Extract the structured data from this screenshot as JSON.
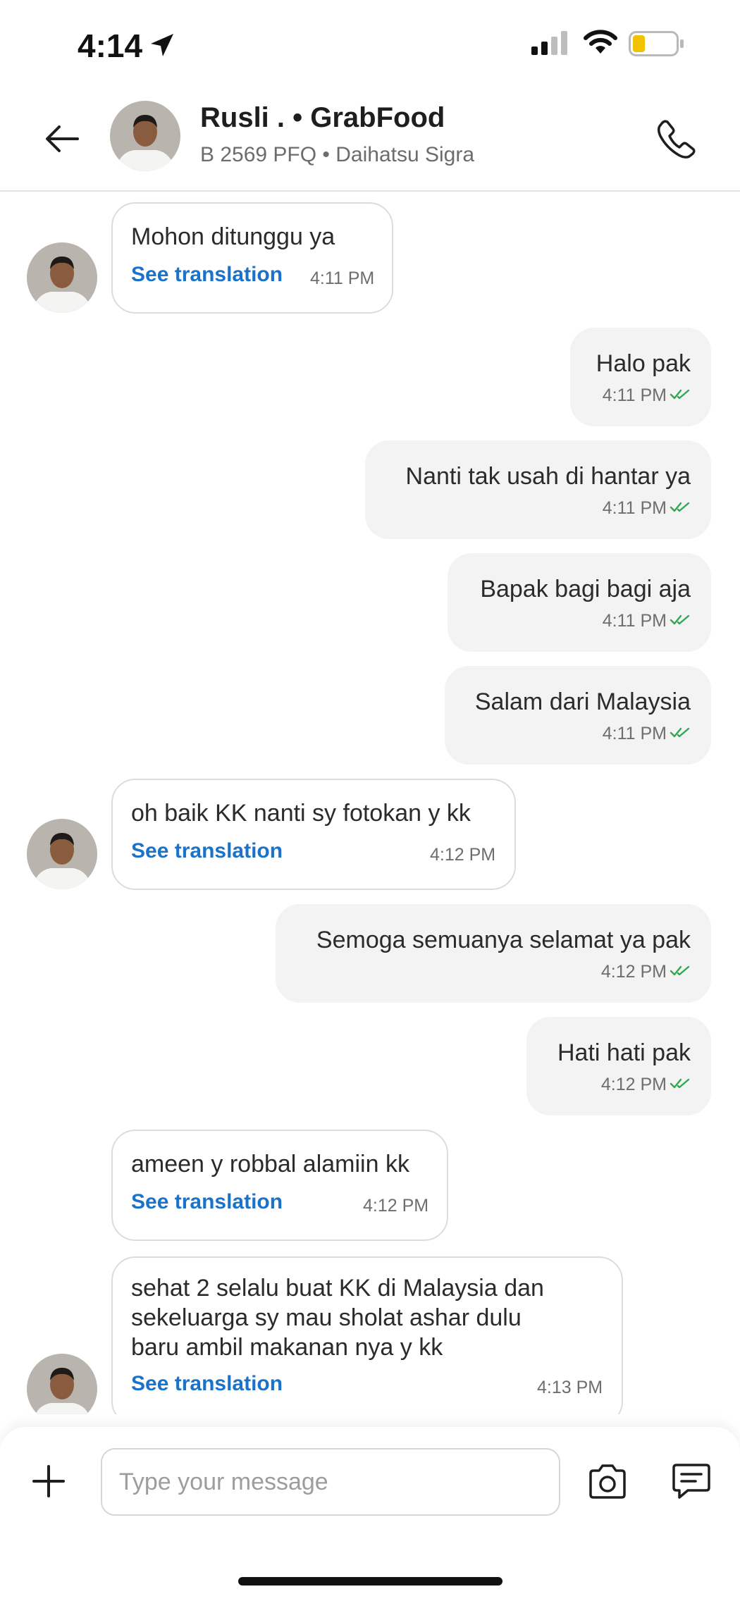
{
  "status_bar": {
    "time": "4:14"
  },
  "header": {
    "title": "Rusli . • GrabFood",
    "subtitle": "B 2569 PFQ • Daihatsu Sigra"
  },
  "messages": [
    {
      "side": "in",
      "text": "Mohon ditunggu ya",
      "translate": "See translation",
      "time": "4:11 PM"
    },
    {
      "side": "out",
      "text": "Halo pak",
      "time": "4:11 PM"
    },
    {
      "side": "out",
      "text": "Nanti tak usah di hantar ya",
      "time": "4:11 PM"
    },
    {
      "side": "out",
      "text": "Bapak bagi bagi aja",
      "time": "4:11 PM"
    },
    {
      "side": "out",
      "text": "Salam dari Malaysia",
      "time": "4:11 PM"
    },
    {
      "side": "in",
      "text": "oh baik KK nanti sy fotokan y kk",
      "translate": "See translation",
      "time": "4:12 PM"
    },
    {
      "side": "out",
      "text": "Semoga semuanya selamat ya pak",
      "time": "4:12 PM"
    },
    {
      "side": "out",
      "text": "Hati hati pak",
      "time": "4:12 PM"
    },
    {
      "side": "in",
      "text": "ameen y robbal alamiin kk",
      "translate": "See translation",
      "time": "4:12 PM"
    },
    {
      "side": "in",
      "lines": [
        "sehat 2 selalu buat KK di Malaysia dan",
        "sekeluarga sy mau sholat ashar dulu",
        "baru ambil makanan nya y kk"
      ],
      "translate": "See translation",
      "time": "4:13 PM"
    }
  ],
  "composer": {
    "placeholder": "Type your message"
  },
  "colors": {
    "link": "#1a73c9",
    "read_ticks": "#2fa84f",
    "incoming_border": "#dcdcdc",
    "outgoing_bg": "#f3f3f3"
  }
}
